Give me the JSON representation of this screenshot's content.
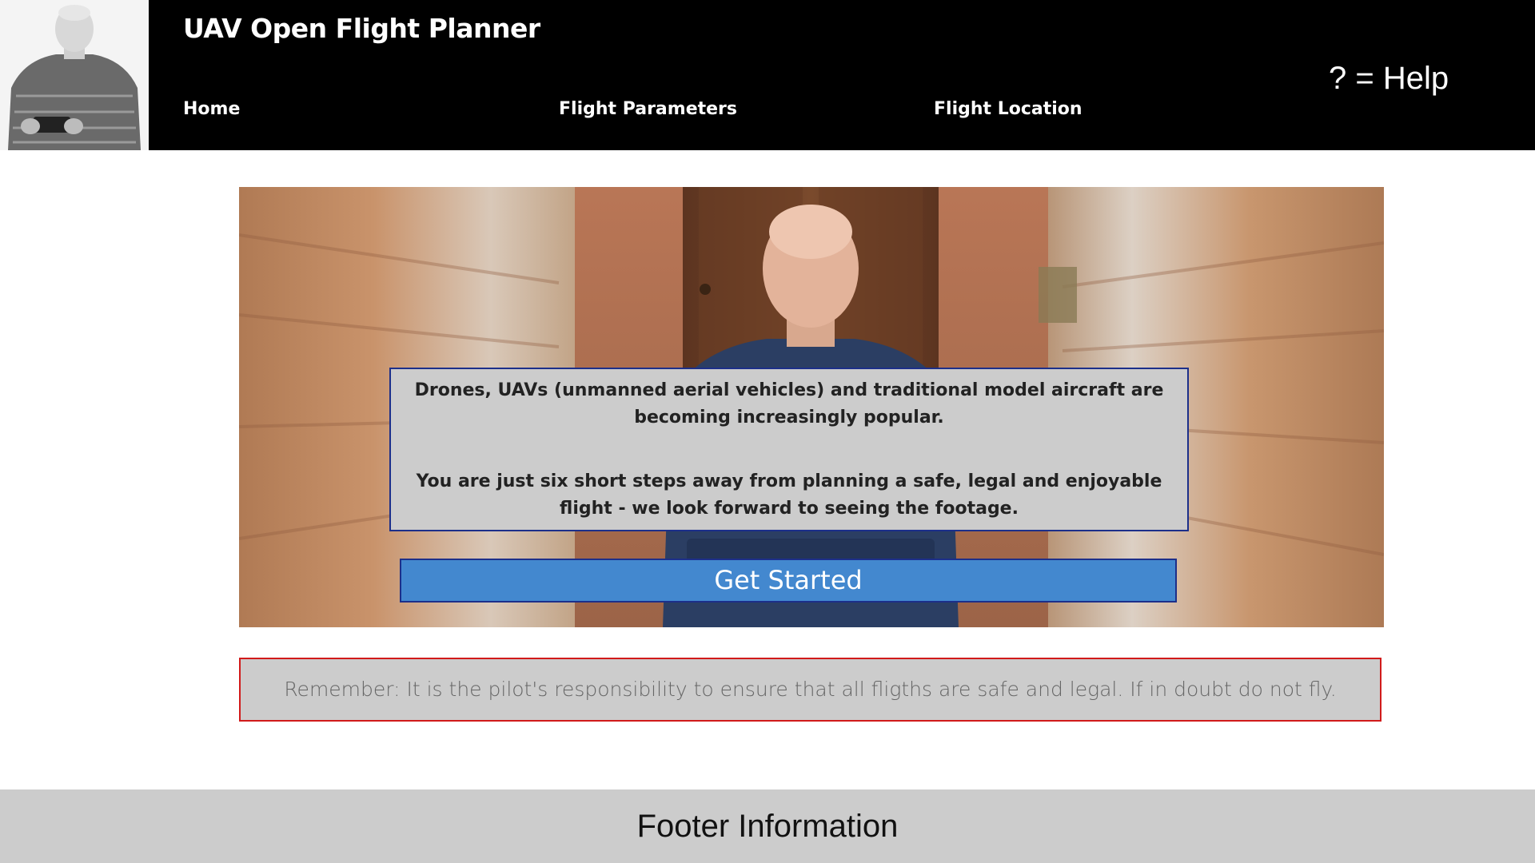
{
  "header": {
    "title": "UAV Open Flight Planner",
    "help_label": "? = Help",
    "nav": [
      {
        "label": "Home"
      },
      {
        "label": "Flight Parameters"
      },
      {
        "label": "Flight Location"
      }
    ]
  },
  "hero": {
    "intro_paragraphs": [
      "Drones, UAVs (unmanned aerial vehicles) and traditional model aircraft are becoming increasingly popular.",
      "You are just six short steps away from planning a safe, legal and enjoyable flight - we look forward to seeing the footage."
    ],
    "cta_label": "Get Started"
  },
  "warning": {
    "text": "Remember: It is the pilot's responsibility to ensure that all fligths are safe and legal.  If in doubt do not fly."
  },
  "footer": {
    "text": "Footer Information"
  },
  "colors": {
    "header_bg": "#000000",
    "cta_bg": "#4388cf",
    "box_border": "#1c2f8a",
    "warning_border": "#d11a1a",
    "panel_bg": "#cccccc"
  }
}
